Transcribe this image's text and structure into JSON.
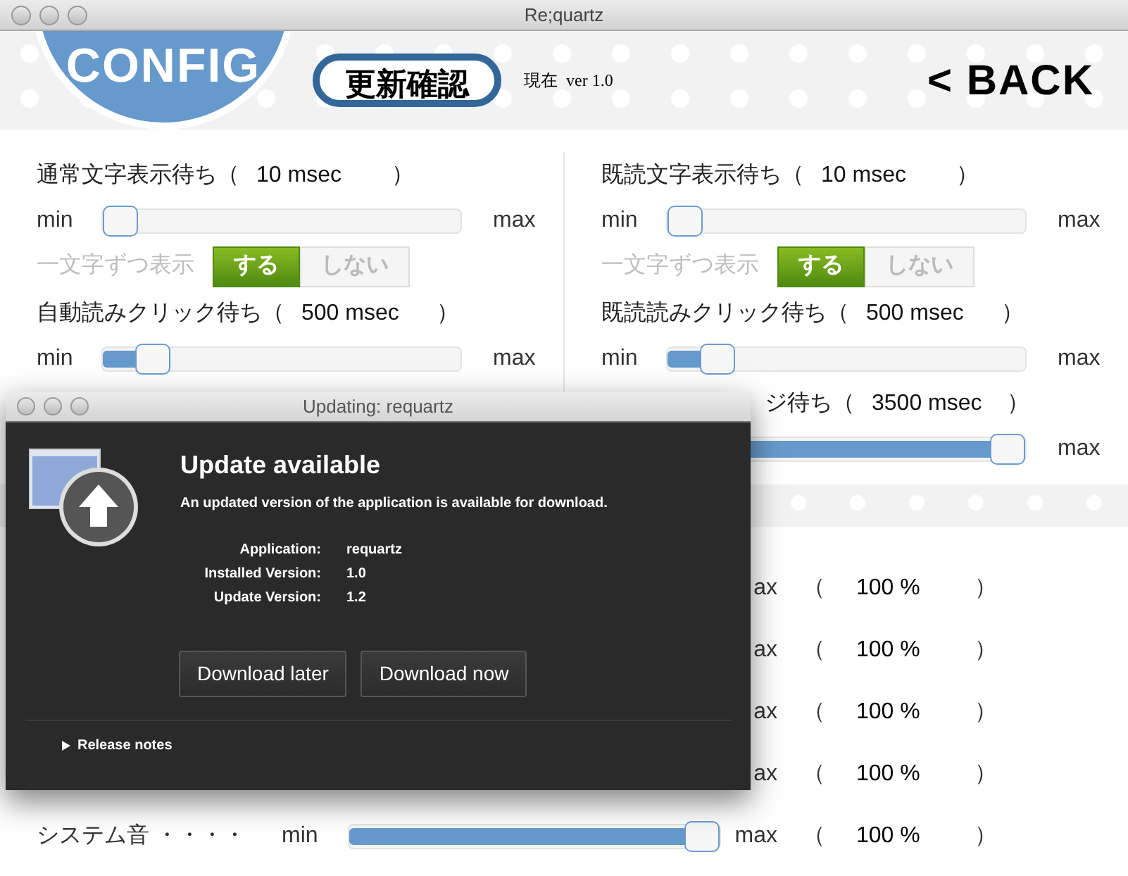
{
  "window": {
    "title": "Re;quartz"
  },
  "header": {
    "logo": "CONFIG",
    "update_button": "更新確認",
    "version": "現在  ver 1.0",
    "back_button": "< BACK"
  },
  "columns": [
    {
      "rows": [
        {
          "kind": "slider",
          "label": "通常文字表示待ち（",
          "value": "10 msec",
          "close": "）",
          "min": "min",
          "max": "max",
          "level": 0
        },
        {
          "kind": "toggle",
          "label": "一文字ずつ表示",
          "options": [
            {
              "label": "する",
              "selected": true
            },
            {
              "label": "しない",
              "selected": false
            }
          ]
        },
        {
          "kind": "slider",
          "label": "自動読みクリック待ち（",
          "value": "500 msec",
          "close": "）",
          "min": "min",
          "max": "max",
          "level": 0.1
        }
      ]
    },
    {
      "rows": [
        {
          "kind": "slider",
          "label": "既読文字表示待ち（",
          "value": "10 msec",
          "close": "）",
          "min": "min",
          "max": "max",
          "level": 0
        },
        {
          "kind": "toggle",
          "label": "一文字ずつ表示",
          "options": [
            {
              "label": "する",
              "selected": true
            },
            {
              "label": "しない",
              "selected": false
            }
          ]
        },
        {
          "kind": "slider",
          "label": "既読読みクリック待ち（",
          "value": "500 msec",
          "close": "）",
          "min": "min",
          "max": "max",
          "level": 0.1
        },
        {
          "kind": "partial",
          "label": "ジ待ち（",
          "value": "3500 msec",
          "close": "）",
          "max": "max",
          "level": 1
        }
      ]
    }
  ],
  "volume_rows": [
    {
      "kind": "partial",
      "max": "ax",
      "open": "（",
      "value": "100 %",
      "close": "）"
    },
    {
      "kind": "partial",
      "max": "ax",
      "open": "（",
      "value": "100 %",
      "close": "）"
    },
    {
      "kind": "partial",
      "max": "ax",
      "open": "（",
      "value": "100 %",
      "close": "）"
    },
    {
      "kind": "partial",
      "max": "ax",
      "open": "（",
      "value": "100 %",
      "close": "）"
    },
    {
      "kind": "full",
      "label": "システム音 ・・・・",
      "min": "min",
      "max": "max",
      "level": 1,
      "open": "（",
      "value": "100 %",
      "close": "）"
    }
  ],
  "dialog": {
    "title": "Updating: requartz",
    "heading": "Update available",
    "message": "An updated version of the application is available for download.",
    "info": [
      {
        "label": "Application:",
        "value": "requartz"
      },
      {
        "label": "Installed Version:",
        "value": "1.0"
      },
      {
        "label": "Update Version:",
        "value": "1.2"
      }
    ],
    "buttons": [
      "Download later",
      "Download now"
    ],
    "disclosure": {
      "label": "Release notes",
      "expanded": false
    }
  }
}
